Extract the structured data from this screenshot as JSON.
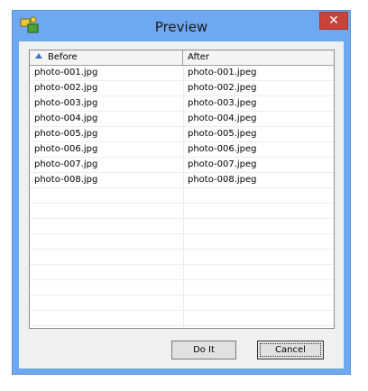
{
  "window": {
    "title": "Preview",
    "close_glyph": "✕"
  },
  "list": {
    "columns": {
      "before": "Before",
      "after": "After"
    },
    "sort_indicator": "sort-ascending-icon",
    "rows": [
      {
        "before": "photo-001.jpg",
        "after": "photo-001.jpeg"
      },
      {
        "before": "photo-002.jpg",
        "after": "photo-002.jpeg"
      },
      {
        "before": "photo-003.jpg",
        "after": "photo-003.jpeg"
      },
      {
        "before": "photo-004.jpg",
        "after": "photo-004.jpeg"
      },
      {
        "before": "photo-005.jpg",
        "after": "photo-005.jpeg"
      },
      {
        "before": "photo-006.jpg",
        "after": "photo-006.jpeg"
      },
      {
        "before": "photo-007.jpg",
        "after": "photo-007.jpeg"
      },
      {
        "before": "photo-008.jpg",
        "after": "photo-008.jpeg"
      },
      {
        "before": "",
        "after": ""
      },
      {
        "before": "",
        "after": ""
      },
      {
        "before": "",
        "after": ""
      },
      {
        "before": "",
        "after": ""
      },
      {
        "before": "",
        "after": ""
      },
      {
        "before": "",
        "after": ""
      },
      {
        "before": "",
        "after": ""
      },
      {
        "before": "",
        "after": ""
      },
      {
        "before": "",
        "after": ""
      }
    ]
  },
  "buttons": {
    "do_it": "Do It",
    "cancel": "Cancel"
  },
  "colors": {
    "frame": "#6ea8f0",
    "close": "#c7433a",
    "sort_arrow": "#3a78c8"
  }
}
